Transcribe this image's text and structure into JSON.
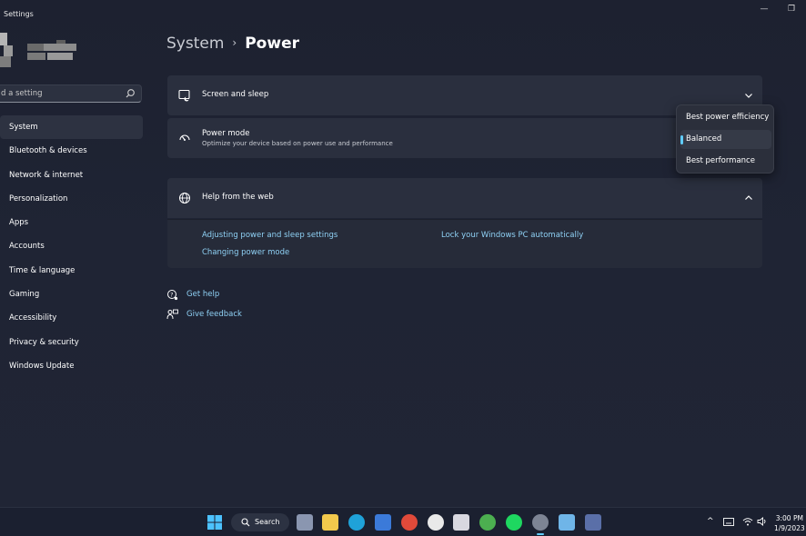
{
  "window": {
    "title": "Settings",
    "minimize_glyph": "—",
    "restore_glyph": "❐"
  },
  "sidebar": {
    "search_placeholder": "d a setting",
    "items": [
      {
        "label": "System",
        "selected": true
      },
      {
        "label": "Bluetooth & devices"
      },
      {
        "label": "Network & internet"
      },
      {
        "label": "Personalization"
      },
      {
        "label": "Apps"
      },
      {
        "label": "Accounts"
      },
      {
        "label": "Time & language"
      },
      {
        "label": "Gaming"
      },
      {
        "label": "Accessibility"
      },
      {
        "label": "Privacy & security"
      },
      {
        "label": "Windows Update"
      }
    ]
  },
  "breadcrumb": {
    "parent": "System",
    "separator": "›",
    "current": "Power"
  },
  "screen_sleep": {
    "title": "Screen and sleep",
    "icon": "monitor-sleep-icon"
  },
  "power_mode": {
    "title": "Power mode",
    "subtitle": "Optimize your device based on power use and performance",
    "icon": "gauge-icon",
    "options": [
      "Best power efficiency",
      "Balanced",
      "Best performance"
    ],
    "selected": "Balanced"
  },
  "help_web": {
    "title": "Help from the web",
    "icon": "globe-icon",
    "links": [
      "Adjusting power and sleep settings",
      "Changing power mode",
      "Lock your Windows PC automatically"
    ]
  },
  "footer": {
    "get_help": "Get help",
    "give_feedback": "Give feedback"
  },
  "taskbar": {
    "search_label": "Search",
    "time": "3:00 PM",
    "date": "1/9/2023",
    "accent": "#60cdff"
  }
}
